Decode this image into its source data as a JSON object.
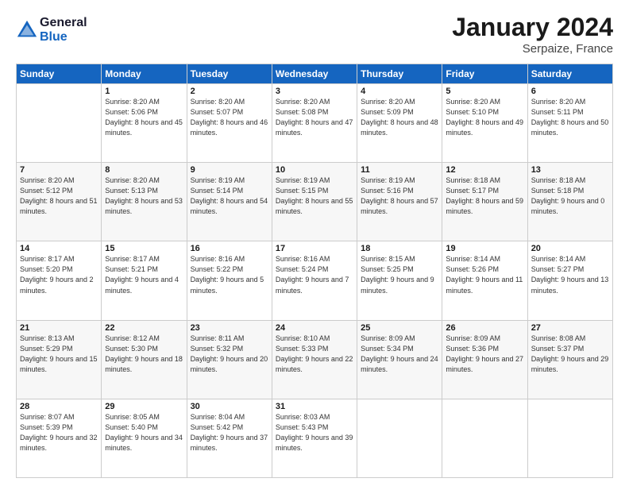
{
  "logo": {
    "general": "General",
    "blue": "Blue"
  },
  "header": {
    "month": "January 2024",
    "location": "Serpaize, France"
  },
  "weekdays": [
    "Sunday",
    "Monday",
    "Tuesday",
    "Wednesday",
    "Thursday",
    "Friday",
    "Saturday"
  ],
  "weeks": [
    [
      {
        "day": "",
        "sunrise": "",
        "sunset": "",
        "daylight": ""
      },
      {
        "day": "1",
        "sunrise": "Sunrise: 8:20 AM",
        "sunset": "Sunset: 5:06 PM",
        "daylight": "Daylight: 8 hours and 45 minutes."
      },
      {
        "day": "2",
        "sunrise": "Sunrise: 8:20 AM",
        "sunset": "Sunset: 5:07 PM",
        "daylight": "Daylight: 8 hours and 46 minutes."
      },
      {
        "day": "3",
        "sunrise": "Sunrise: 8:20 AM",
        "sunset": "Sunset: 5:08 PM",
        "daylight": "Daylight: 8 hours and 47 minutes."
      },
      {
        "day": "4",
        "sunrise": "Sunrise: 8:20 AM",
        "sunset": "Sunset: 5:09 PM",
        "daylight": "Daylight: 8 hours and 48 minutes."
      },
      {
        "day": "5",
        "sunrise": "Sunrise: 8:20 AM",
        "sunset": "Sunset: 5:10 PM",
        "daylight": "Daylight: 8 hours and 49 minutes."
      },
      {
        "day": "6",
        "sunrise": "Sunrise: 8:20 AM",
        "sunset": "Sunset: 5:11 PM",
        "daylight": "Daylight: 8 hours and 50 minutes."
      }
    ],
    [
      {
        "day": "7",
        "sunrise": "Sunrise: 8:20 AM",
        "sunset": "Sunset: 5:12 PM",
        "daylight": "Daylight: 8 hours and 51 minutes."
      },
      {
        "day": "8",
        "sunrise": "Sunrise: 8:20 AM",
        "sunset": "Sunset: 5:13 PM",
        "daylight": "Daylight: 8 hours and 53 minutes."
      },
      {
        "day": "9",
        "sunrise": "Sunrise: 8:19 AM",
        "sunset": "Sunset: 5:14 PM",
        "daylight": "Daylight: 8 hours and 54 minutes."
      },
      {
        "day": "10",
        "sunrise": "Sunrise: 8:19 AM",
        "sunset": "Sunset: 5:15 PM",
        "daylight": "Daylight: 8 hours and 55 minutes."
      },
      {
        "day": "11",
        "sunrise": "Sunrise: 8:19 AM",
        "sunset": "Sunset: 5:16 PM",
        "daylight": "Daylight: 8 hours and 57 minutes."
      },
      {
        "day": "12",
        "sunrise": "Sunrise: 8:18 AM",
        "sunset": "Sunset: 5:17 PM",
        "daylight": "Daylight: 8 hours and 59 minutes."
      },
      {
        "day": "13",
        "sunrise": "Sunrise: 8:18 AM",
        "sunset": "Sunset: 5:18 PM",
        "daylight": "Daylight: 9 hours and 0 minutes."
      }
    ],
    [
      {
        "day": "14",
        "sunrise": "Sunrise: 8:17 AM",
        "sunset": "Sunset: 5:20 PM",
        "daylight": "Daylight: 9 hours and 2 minutes."
      },
      {
        "day": "15",
        "sunrise": "Sunrise: 8:17 AM",
        "sunset": "Sunset: 5:21 PM",
        "daylight": "Daylight: 9 hours and 4 minutes."
      },
      {
        "day": "16",
        "sunrise": "Sunrise: 8:16 AM",
        "sunset": "Sunset: 5:22 PM",
        "daylight": "Daylight: 9 hours and 5 minutes."
      },
      {
        "day": "17",
        "sunrise": "Sunrise: 8:16 AM",
        "sunset": "Sunset: 5:24 PM",
        "daylight": "Daylight: 9 hours and 7 minutes."
      },
      {
        "day": "18",
        "sunrise": "Sunrise: 8:15 AM",
        "sunset": "Sunset: 5:25 PM",
        "daylight": "Daylight: 9 hours and 9 minutes."
      },
      {
        "day": "19",
        "sunrise": "Sunrise: 8:14 AM",
        "sunset": "Sunset: 5:26 PM",
        "daylight": "Daylight: 9 hours and 11 minutes."
      },
      {
        "day": "20",
        "sunrise": "Sunrise: 8:14 AM",
        "sunset": "Sunset: 5:27 PM",
        "daylight": "Daylight: 9 hours and 13 minutes."
      }
    ],
    [
      {
        "day": "21",
        "sunrise": "Sunrise: 8:13 AM",
        "sunset": "Sunset: 5:29 PM",
        "daylight": "Daylight: 9 hours and 15 minutes."
      },
      {
        "day": "22",
        "sunrise": "Sunrise: 8:12 AM",
        "sunset": "Sunset: 5:30 PM",
        "daylight": "Daylight: 9 hours and 18 minutes."
      },
      {
        "day": "23",
        "sunrise": "Sunrise: 8:11 AM",
        "sunset": "Sunset: 5:32 PM",
        "daylight": "Daylight: 9 hours and 20 minutes."
      },
      {
        "day": "24",
        "sunrise": "Sunrise: 8:10 AM",
        "sunset": "Sunset: 5:33 PM",
        "daylight": "Daylight: 9 hours and 22 minutes."
      },
      {
        "day": "25",
        "sunrise": "Sunrise: 8:09 AM",
        "sunset": "Sunset: 5:34 PM",
        "daylight": "Daylight: 9 hours and 24 minutes."
      },
      {
        "day": "26",
        "sunrise": "Sunrise: 8:09 AM",
        "sunset": "Sunset: 5:36 PM",
        "daylight": "Daylight: 9 hours and 27 minutes."
      },
      {
        "day": "27",
        "sunrise": "Sunrise: 8:08 AM",
        "sunset": "Sunset: 5:37 PM",
        "daylight": "Daylight: 9 hours and 29 minutes."
      }
    ],
    [
      {
        "day": "28",
        "sunrise": "Sunrise: 8:07 AM",
        "sunset": "Sunset: 5:39 PM",
        "daylight": "Daylight: 9 hours and 32 minutes."
      },
      {
        "day": "29",
        "sunrise": "Sunrise: 8:05 AM",
        "sunset": "Sunset: 5:40 PM",
        "daylight": "Daylight: 9 hours and 34 minutes."
      },
      {
        "day": "30",
        "sunrise": "Sunrise: 8:04 AM",
        "sunset": "Sunset: 5:42 PM",
        "daylight": "Daylight: 9 hours and 37 minutes."
      },
      {
        "day": "31",
        "sunrise": "Sunrise: 8:03 AM",
        "sunset": "Sunset: 5:43 PM",
        "daylight": "Daylight: 9 hours and 39 minutes."
      },
      {
        "day": "",
        "sunrise": "",
        "sunset": "",
        "daylight": ""
      },
      {
        "day": "",
        "sunrise": "",
        "sunset": "",
        "daylight": ""
      },
      {
        "day": "",
        "sunrise": "",
        "sunset": "",
        "daylight": ""
      }
    ]
  ]
}
